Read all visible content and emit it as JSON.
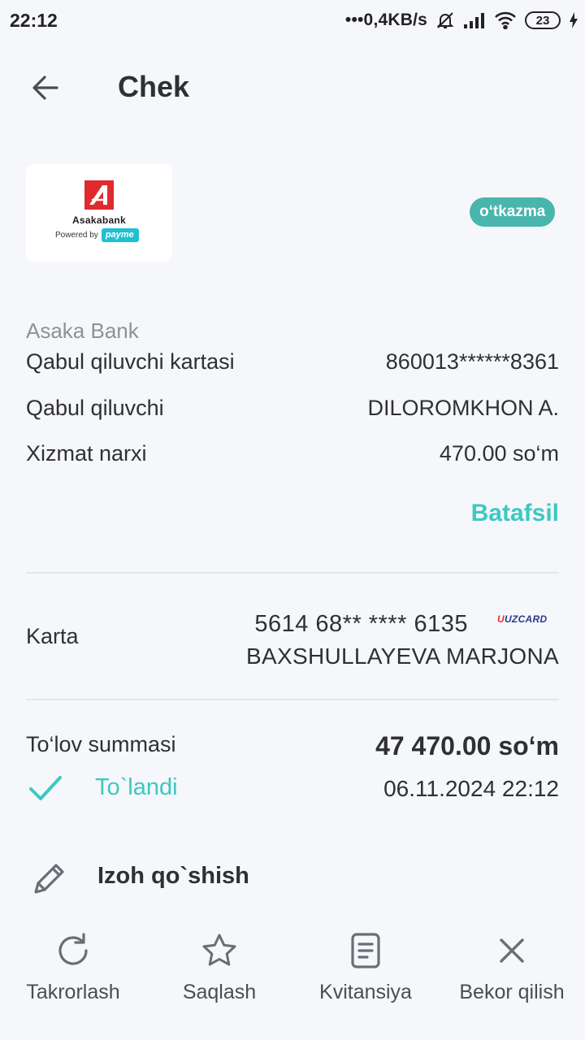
{
  "status_bar": {
    "time": "22:12",
    "network_speed": "•••0,4KB/s",
    "battery": "23",
    "icons": [
      "bell-muted-icon",
      "signal-icon",
      "wifi-icon",
      "battery-icon",
      "charging-icon"
    ]
  },
  "header": {
    "title": "Chek",
    "back_icon": "arrow-left-icon"
  },
  "merchant": {
    "logo_name": "Asakabank",
    "powered_by": "Powered by",
    "powered_brand": "payme",
    "type_badge": "o‘tkazma",
    "bank_name": "Asaka Bank"
  },
  "details": [
    {
      "label": "Qabul qiluvchi kartasi",
      "value": "860013******8361"
    },
    {
      "label": "Qabul qiluvchi",
      "value": "DILOROMKHON A."
    },
    {
      "label": "Xizmat narxi",
      "value": "470.00 so‘m"
    }
  ],
  "more_link": "Batafsil",
  "card": {
    "label": "Karta",
    "number": "5614 68** **** 6135",
    "brand": "UZCARD",
    "holder": "BAXSHULLAYEVA MARJONA"
  },
  "payment": {
    "label": "To‘lov summasi",
    "amount": "47 470.00 so‘m",
    "status": "To`landi",
    "date": "06.11.2024 22:12"
  },
  "comment": {
    "label": "Izoh qo`shish"
  },
  "actions": [
    {
      "label": "Takrorlash",
      "icon": "refresh-icon"
    },
    {
      "label": "Saqlash",
      "icon": "star-icon"
    },
    {
      "label": "Kvitansiya",
      "icon": "receipt-icon"
    },
    {
      "label": "Bekor qilish",
      "icon": "close-icon"
    }
  ],
  "colors": {
    "accent": "#3cc8c4",
    "badge": "#49b5ad",
    "background": "#f5f7fa",
    "text": "#2f3033",
    "muted": "#8e9297"
  }
}
